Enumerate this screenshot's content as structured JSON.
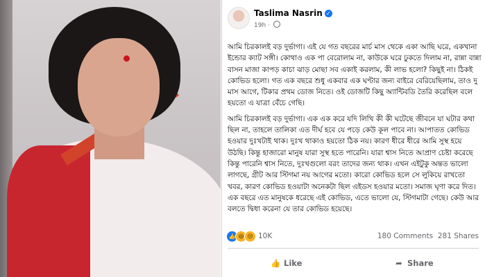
{
  "post": {
    "author": "Taslima Nasrin",
    "time": "19h",
    "paragraphs": [
      "আমি চিরকালই বড় দুর্ভাগা। এই যে গত বছরের মার্চ মাস থেকে একা আছি ঘরে, একখানা ইন্ডোর ক্যাট সঙ্গী। কোথাও এক পা বেরোলাম না, কাউকে ঘরে ঢুকতে দিলাম না, রান্না বান্না বাসন মাজা কাপড় কাচা ঝাড় মোছা সব একাই করলাম, কী লাভ হলো? কিছুই না। ঠিকই কোভিড হলো। গত এক বছরে শুধু একবার এক ঘণ্টার জন্য বাইরে বেরিয়েছিলাম, তাও দু মাস আগে, টিকার প্রথম ডোজ নিতে। ওই ডোজটি কিছু অ্যান্টিবডি তৈরি করেছিল বলে হয়তো এ যাত্রা বেঁচে গেছি।",
      "আমি চিরকালই বড় দুর্ভাগা। এক এক করে যদি লিখি কী কী ঘটেছে জীবনে যা ঘটার কথা ছিল না, তাহলে তালিকা এত দীর্ঘ হবে যে পড়ে কেউ কূল পাবে না। আপাতত কোভিড হওয়ার দুঃখটাই থাক। দুঃখ থাকাও হয়তো ঠিক নয়। কারণ ধীরে ধীরে আমি সুস্থ হয়ে উঠছি। কিন্তু হাজারো মানুষ যারা সুস্থ হতে পারেনি। যারা শ্বাস নিতে আপ্রাণ চেষ্টা করেছে কিন্তু পারেনি শ্বাস নিতে, দুঃখগুলো বরং তাদের জন্য থাক। এখন এইটুকু অন্তত ভালো লাগছে, গ্রীট আর স্টিগমা নয় আগের মতো। কারো কোভিড হলে সে লুকিয়ে রাখতো খবর, কারণ কোভিড হওয়াটা অনেকটা ছিল এইডস হওয়ার মতো। সমাজ ঘৃণা করে দিত। এক বছরে এত মানুষকে ধরেছে এই কোভিড, এতে ভালো যে, স্টিগমাটা গেছে। কেউ আর বলতে দ্বিধা করেনা যে তার কোভিড হয়েছে।"
    ]
  },
  "reactions": {
    "icons": [
      "like-icon",
      "haha-icon",
      "sad-icon"
    ],
    "count": "10K"
  },
  "stats": {
    "comments": "180 Comments",
    "shares": "281 Shares"
  },
  "actions": {
    "like_label": "Like",
    "share_label": "Share"
  },
  "colors": {
    "facebook_blue": "#1877f2",
    "meta_gray": "#65676b"
  }
}
